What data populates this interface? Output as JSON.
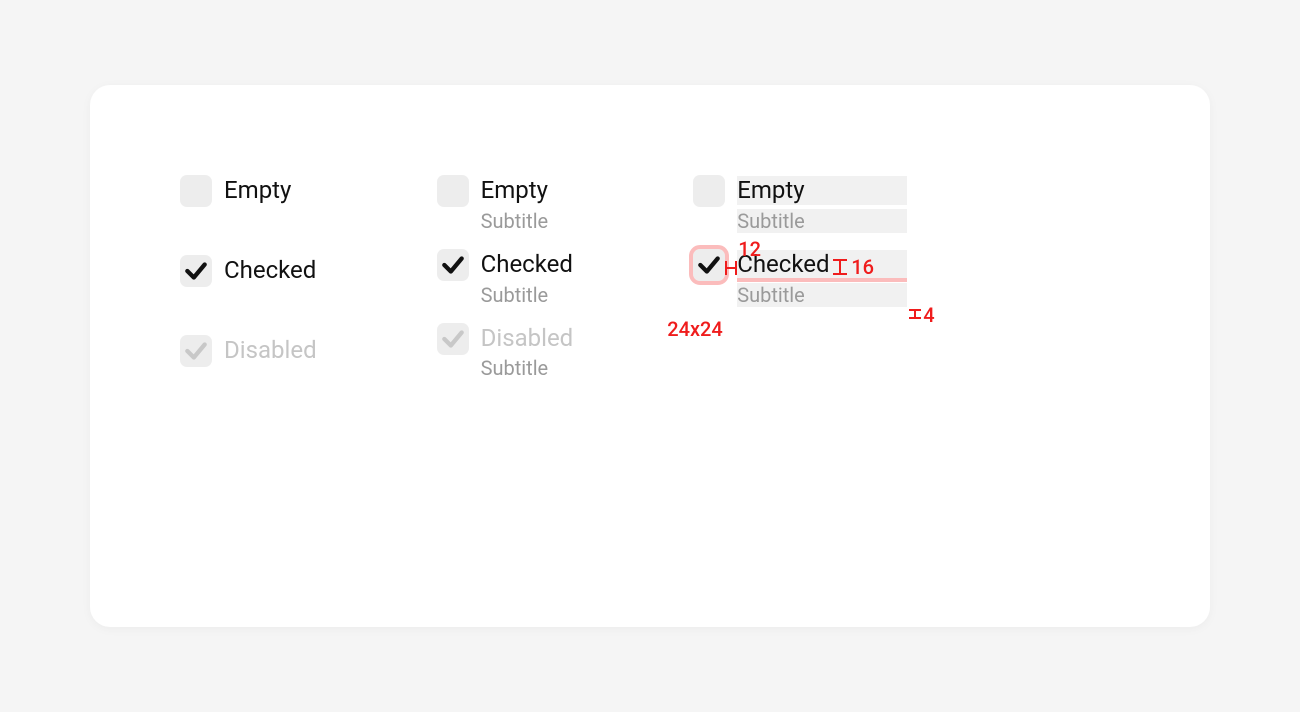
{
  "col1": {
    "items": [
      {
        "title": "Empty",
        "state": "empty"
      },
      {
        "title": "Checked",
        "state": "checked"
      },
      {
        "title": "Disabled",
        "state": "disabled"
      }
    ]
  },
  "col2": {
    "items": [
      {
        "title": "Empty",
        "subtitle": "Subtitle",
        "state": "empty"
      },
      {
        "title": "Checked",
        "subtitle": "Subtitle",
        "state": "checked"
      },
      {
        "title": "Disabled",
        "subtitle": "Subtitle",
        "state": "disabled"
      }
    ]
  },
  "col3": {
    "items": [
      {
        "title": "Empty",
        "subtitle": "Subtitle",
        "state": "empty"
      },
      {
        "title": "Checked",
        "subtitle": "Subtitle",
        "state": "checked"
      }
    ],
    "annotations": {
      "gap_horizontal": "12",
      "gap_vertical_items": "16",
      "gap_title_subtitle": "4",
      "checkbox_size": "24x24"
    }
  }
}
